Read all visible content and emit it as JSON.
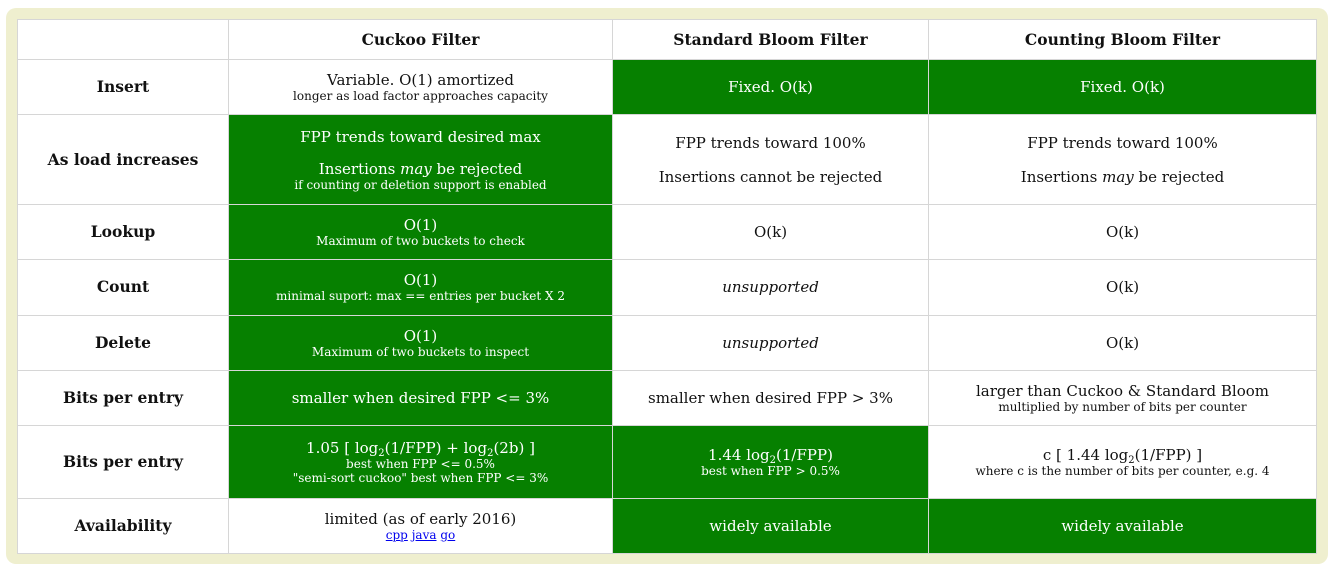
{
  "headers": {
    "col1": "Cuckoo Filter",
    "col2": "Standard Bloom Filter",
    "col3": "Counting Bloom Filter"
  },
  "rows": {
    "insert": {
      "label": "Insert",
      "cuckoo_main": "Variable. O(1) amortized",
      "cuckoo_note": "longer as load factor approaches capacity",
      "standard": "Fixed. O(k)",
      "counting": "Fixed. O(k)"
    },
    "load": {
      "label": "As load increases",
      "cuckoo_line1": "FPP trends toward desired max",
      "cuckoo_line2_pre": "Insertions ",
      "cuckoo_line2_em": "may",
      "cuckoo_line2_post": " be rejected",
      "cuckoo_note": "if counting or deletion support is enabled",
      "standard_line1": "FPP trends toward 100%",
      "standard_line2": "Insertions cannot be rejected",
      "counting_line1": "FPP trends toward 100%",
      "counting_line2_pre": "Insertions ",
      "counting_line2_em": "may",
      "counting_line2_post": " be rejected"
    },
    "lookup": {
      "label": "Lookup",
      "cuckoo_main": "O(1)",
      "cuckoo_note": "Maximum of two buckets to check",
      "standard": "O(k)",
      "counting": "O(k)"
    },
    "count": {
      "label": "Count",
      "cuckoo_main": "O(1)",
      "cuckoo_note": "minimal suport: max == entries per bucket X 2",
      "standard": "unsupported",
      "counting": "O(k)"
    },
    "delete": {
      "label": "Delete",
      "cuckoo_main": "O(1)",
      "cuckoo_note": "Maximum of two buckets to inspect",
      "standard": "unsupported",
      "counting": "O(k)"
    },
    "bits1": {
      "label": "Bits per entry",
      "cuckoo": "smaller when desired FPP <= 3%",
      "standard": "smaller when desired FPP > 3%",
      "counting_main": "larger than Cuckoo & Standard Bloom",
      "counting_note": "multiplied by number of bits per counter"
    },
    "bits2": {
      "label": "Bits per entry",
      "cuckoo_a": "1.05 [ log",
      "cuckoo_sub1": "2",
      "cuckoo_b": "(1/FPP) + log",
      "cuckoo_sub2": "2",
      "cuckoo_c": "(2b) ]",
      "cuckoo_note1": "best when FPP <= 0.5%",
      "cuckoo_note2": "\"semi-sort cuckoo\" best when FPP <= 3%",
      "standard_a": "1.44 log",
      "standard_sub": "2",
      "standard_b": "(1/FPP)",
      "standard_note": "best when FPP > 0.5%",
      "counting_a": "c [ 1.44 log",
      "counting_sub": "2",
      "counting_b": "(1/FPP) ]",
      "counting_note": "where c is the number of bits per counter, e.g. 4"
    },
    "availability": {
      "label": "Availability",
      "cuckoo_main": "limited (as of early 2016)",
      "links": [
        "cpp",
        "java",
        "go"
      ],
      "standard": "widely available",
      "counting": "widely available"
    }
  },
  "colors": {
    "highlight": "#068000",
    "frame": "#efefcf",
    "border": "#d6d6d6"
  }
}
